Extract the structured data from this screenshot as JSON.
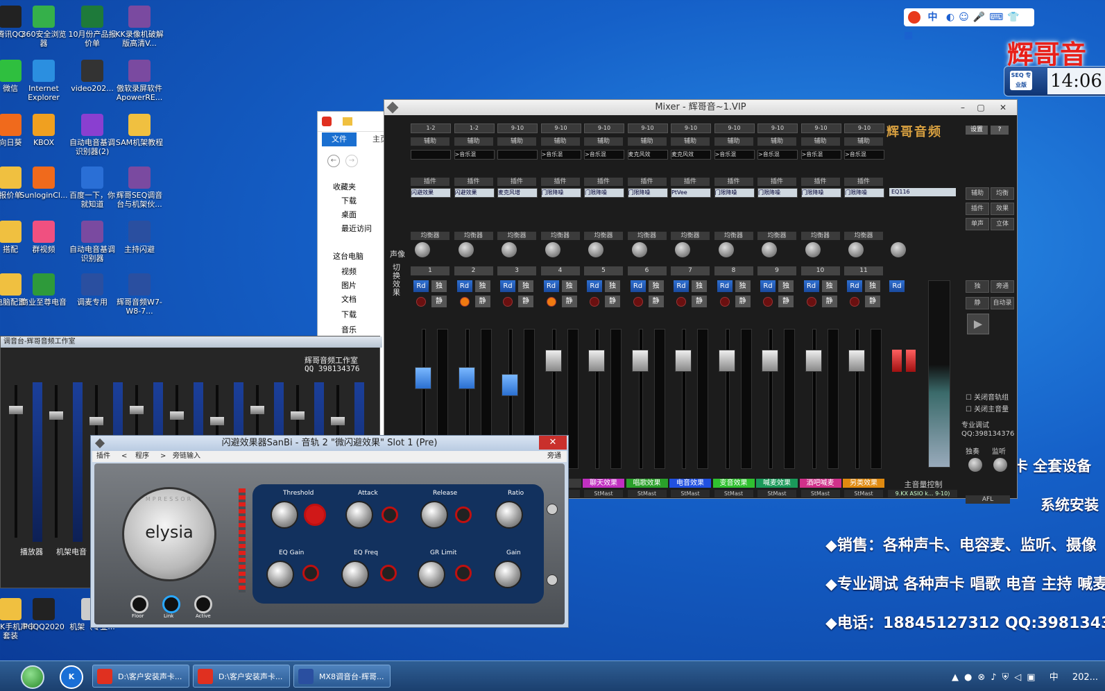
{
  "desktop": {
    "icons": [
      {
        "label": "腾讯QQ",
        "icon": "qq-icon",
        "color": "#222222"
      },
      {
        "label": "360安全浏览器",
        "icon": "browser-360-icon",
        "color": "#35b04a"
      },
      {
        "label": "10月份产品报价单",
        "icon": "excel-icon",
        "color": "#1e7a3a"
      },
      {
        "label": "KK录像机破解版高清V...",
        "icon": "rar-icon",
        "color": "#7a4aa0"
      },
      {
        "label": "微信",
        "icon": "wechat-icon",
        "color": "#2fbf3f"
      },
      {
        "label": "Internet Explorer",
        "icon": "ie-icon",
        "color": "#2b8fe0"
      },
      {
        "label": "video202...",
        "icon": "video-icon",
        "color": "#333333"
      },
      {
        "label": "傲软录屏软件ApowerRE...",
        "icon": "rar-icon",
        "color": "#7a4aa0"
      },
      {
        "label": "向日葵",
        "icon": "sunflower-icon",
        "color": "#f06a1c"
      },
      {
        "label": "KBOX",
        "icon": "kbox-icon",
        "color": "#f0a020"
      },
      {
        "label": "自动电音基调识别器(2)",
        "icon": "tuner-icon",
        "color": "#8a3fd0"
      },
      {
        "label": "SAM机架教程",
        "icon": "folder-icon",
        "color": "#f0c040"
      },
      {
        "label": "报价单",
        "icon": "folder-icon",
        "color": "#f0c040"
      },
      {
        "label": "SunloginCl...",
        "icon": "sunlogin-icon",
        "color": "#f06a1c"
      },
      {
        "label": "百度一下，你就知道",
        "icon": "baidu-icon",
        "color": "#2a6fd6"
      },
      {
        "label": "辉哥SEQ调音台与机架伙...",
        "icon": "rar-icon",
        "color": "#7a4aa0"
      },
      {
        "label": "搭配",
        "icon": "folder-icon",
        "color": "#f0c040"
      },
      {
        "label": "群视频",
        "icon": "group-video-icon",
        "color": "#f05080"
      },
      {
        "label": "自动电音基调识别器",
        "icon": "rar-icon",
        "color": "#7a4aa0"
      },
      {
        "label": "主持闪避",
        "icon": "mx-icon",
        "color": "#2a4fa0"
      },
      {
        "label": "电脑配置",
        "icon": "folder-icon",
        "color": "#f0c040"
      },
      {
        "label": "商业至尊电音",
        "icon": "professor-icon",
        "color": "#2e9a3a"
      },
      {
        "label": "调麦专用",
        "icon": "mx-icon",
        "color": "#2a4fa0"
      },
      {
        "label": "辉哥音频W7-W8-7...",
        "icon": "mx-icon",
        "color": "#2a4fa0"
      },
      {
        "label": "数ISK手机声卡套装",
        "icon": "folder-icon",
        "color": "#f0c040"
      },
      {
        "label": "PCQQ2020",
        "icon": "qq-icon",
        "color": "#222222"
      },
      {
        "label": "机架（专业...",
        "icon": "file-icon",
        "color": "#cccccc"
      }
    ]
  },
  "ime": {
    "labels": [
      "中"
    ],
    "icon": "sogou-icon"
  },
  "clock": {
    "time": "14:06",
    "logo": "SEQ 专业版"
  },
  "banner": {
    "brand": "辉哥音",
    "lines": [
      "声卡 全套设备",
      "系统安装",
      "◆销售：各种声卡、电容麦、监听、摄像",
      "◆专业调试 各种声卡 唱歌 电音 主持 喊麦",
      "◆电话：18845127312 QQ:3981343"
    ]
  },
  "explorer": {
    "tabs": [
      "文件",
      "主页"
    ],
    "items": [
      "收藏夹",
      "下载",
      "桌面",
      "最近访问",
      "这台电脑",
      "视频",
      "图片",
      "文档",
      "下载",
      "音乐"
    ]
  },
  "mixer": {
    "title": "Mixer - 辉哥音~1.VIP",
    "brand": "辉哥音频",
    "settings": "设置",
    "help": "?",
    "headers": {
      "aux": "辅助",
      "insert": "插件",
      "eq": "均衡器",
      "pan": "声像",
      "switch": "切换效果"
    },
    "strips": [
      {
        "num": "1",
        "sel": "1-2",
        "slot1": "",
        "ins": "闪避效果",
        "label": "",
        "out": ""
      },
      {
        "num": "2",
        "sel": "1-2",
        "slot1": ">音乐混",
        "ins": "闪避效果",
        "label": "",
        "out": ""
      },
      {
        "num": "3",
        "sel": "9-10",
        "slot1": "",
        "ins": "麦克风增",
        "label": "",
        "out": ""
      },
      {
        "num": "4",
        "sel": "9-10",
        "slot1": ">音乐混",
        "ins": "门限降噪",
        "label": "",
        "out": ""
      },
      {
        "num": "5",
        "sel": "9-10",
        "slot1": ">音乐混",
        "ins": "门限降噪",
        "label": "聊天效果",
        "out": "StMast"
      },
      {
        "num": "6",
        "sel": "9-10",
        "slot1": "麦克风效",
        "ins": "门限降噪",
        "label": "唱歌效果",
        "out": "StMast"
      },
      {
        "num": "7",
        "sel": "9-10",
        "slot1": "麦克风效",
        "ins": "PtVee",
        "label": "电音效果",
        "out": "StMast"
      },
      {
        "num": "8",
        "sel": "9-10",
        "slot1": ">音乐混",
        "ins": "门限降噪",
        "label": "变音效果",
        "out": "StMast"
      },
      {
        "num": "9",
        "sel": "9-10",
        "slot1": ">音乐混",
        "ins": "门限降噪",
        "label": "喊麦效果",
        "out": "StMast"
      },
      {
        "num": "10",
        "sel": "9-10",
        "slot1": ">音乐混",
        "ins": "门限降噪",
        "label": "酒吧喊麦",
        "out": "StMast"
      },
      {
        "num": "11",
        "sel": "9-10",
        "slot1": ">音乐混",
        "ins": "门限降噪",
        "label": "另类效果",
        "out": "StMast"
      }
    ],
    "master": {
      "insert": "EQ116",
      "label": "主音量控制",
      "out": "9.KX ASIO k... 9-10)"
    },
    "side": {
      "buttons": [
        "辅助",
        "均衡",
        "插件",
        "效果",
        "单声",
        "立体",
        "独",
        "旁通",
        "静",
        "自动录音"
      ],
      "checks": [
        "关闭音轨组",
        "关闭主音量"
      ],
      "pro": "专业调试",
      "qq": "QQ:398134376",
      "solo": "独奏",
      "monitor": "监听",
      "afl": "AFL"
    }
  },
  "mini_mixer": {
    "title": "调音台-辉哥音频工作室",
    "brand": "辉哥音频工作室",
    "qq": "QQ 398134376",
    "labels": [
      "播放器",
      "机架电音"
    ]
  },
  "plugin": {
    "title": "闪避效果器SanBi - 音轨 2  \"微闪避效果\" Slot 1 (Pre)",
    "menu": [
      "插件",
      "<",
      "程序",
      ">",
      "旁链输入"
    ],
    "bypass": "旁通",
    "brand": "elysia",
    "ring": "MPRESSOR",
    "knobs": [
      "Threshold",
      "Attack",
      "Release",
      "Ratio",
      "EQ Gain",
      "EQ Freq",
      "GR Limit",
      "Gain"
    ],
    "switches": [
      "Auto Fast",
      "Anti Log",
      "On",
      "x10",
      "On"
    ],
    "jacks": [
      "Floor",
      "Link",
      "Active"
    ]
  },
  "taskbar": {
    "items": [
      {
        "label": "D:\\客户安装声卡...",
        "icon": "app-red-icon"
      },
      {
        "label": "D:\\客户安装声卡...",
        "icon": "app-red-icon"
      },
      {
        "label": "MX8调音台-辉哥...",
        "icon": "mx-icon"
      }
    ],
    "tray": [
      "中",
      "202..."
    ]
  }
}
